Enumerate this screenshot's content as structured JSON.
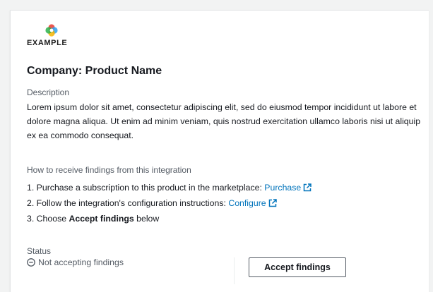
{
  "brand": {
    "logo_icon": "colorful-ring-logo-icon",
    "logo_text": "EXAMPLE"
  },
  "product": {
    "title": "Company: Product Name"
  },
  "description": {
    "label": "Description",
    "text": "Lorem ipsum dolor sit amet, consectetur adipiscing elit, sed do eiusmod tempor incididunt ut labore et dolore magna aliqua. Ut enim ad minim veniam, quis nostrud exercitation ullamco laboris nisi ut aliquip ex ea commodo consequat."
  },
  "howto": {
    "label": "How to receive findings from this integration",
    "steps": [
      {
        "prefix": "1. Purchase a subscription to this product in the marketplace: ",
        "link": "Purchase",
        "icon": "external-link-icon"
      },
      {
        "prefix": "2. Follow the integration's configuration instructions: ",
        "link": "Configure",
        "icon": "external-link-icon"
      },
      {
        "prefix": "3. Choose ",
        "bold": "Accept findings",
        "suffix": " below"
      }
    ]
  },
  "status": {
    "label": "Status",
    "value": "Not accepting findings",
    "icon": "minus-circle-icon"
  },
  "actions": {
    "accept_label": "Accept findings"
  },
  "colors": {
    "link": "#0073bb",
    "text": "#16191f",
    "muted": "#545b64",
    "background": "#f2f3f3"
  }
}
